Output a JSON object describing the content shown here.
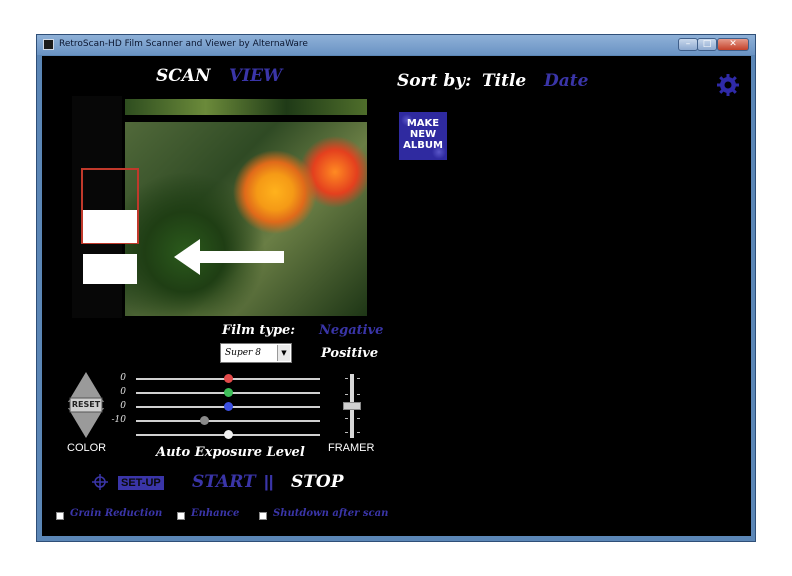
{
  "window": {
    "title": "RetroScan-HD Film Scanner and Viewer by AlternaWare"
  },
  "tabs": {
    "scan": "SCAN",
    "view": "VIEW"
  },
  "sort": {
    "label": "Sort by:",
    "title": "Title",
    "date": "Date"
  },
  "album_button": {
    "lines": [
      "MAKE",
      "NEW",
      "ALBUM"
    ]
  },
  "film": {
    "label": "Film type:",
    "selected": "Super 8",
    "negative": "Negative",
    "positive": "Positive"
  },
  "color_controls": {
    "reset_label": "RESET",
    "color_label": "COLOR",
    "sliders": [
      {
        "name": "red",
        "value": "0",
        "color": "#e24a4a"
      },
      {
        "name": "green",
        "value": "0",
        "color": "#3fbf5a"
      },
      {
        "name": "blue",
        "value": "0",
        "color": "#3b4fe0"
      },
      {
        "name": "gray",
        "value": "-10",
        "color": "#8a8a8a"
      }
    ],
    "auto_exposure_label": "Auto Exposure Level"
  },
  "framer": {
    "label": "FRAMER"
  },
  "controls": {
    "setup": "SET-UP",
    "start": "START",
    "pause": "||",
    "stop": "STOP"
  },
  "options": {
    "grain": "Grain Reduction",
    "enhance": "Enhance",
    "shutdown": "Shutdown after scan"
  },
  "icons": {
    "gear": "gear-icon",
    "target": "crosshair-icon",
    "arrow": "left-arrow-icon"
  }
}
